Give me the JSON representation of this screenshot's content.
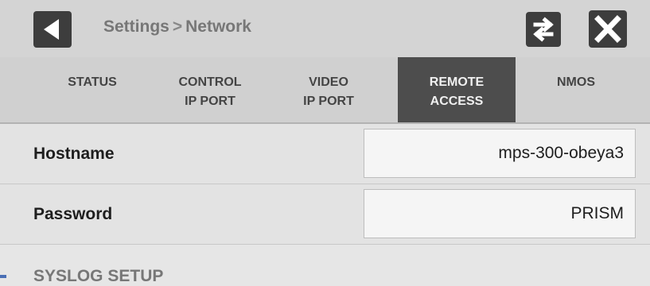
{
  "header": {
    "breadcrumb_parent": "Settings",
    "breadcrumb_separator": ">",
    "breadcrumb_current": "Network",
    "icons": {
      "back": "back-arrow-icon",
      "swap": "swap-arrows-icon",
      "close": "close-x-icon"
    }
  },
  "tabs": [
    {
      "label": "STATUS",
      "active": false
    },
    {
      "label": "CONTROL\nIP PORT",
      "active": false
    },
    {
      "label": "VIDEO\nIP PORT",
      "active": false
    },
    {
      "label": "REMOTE\nACCESS",
      "active": true
    },
    {
      "label": "NMOS",
      "active": false
    }
  ],
  "fields": {
    "hostname": {
      "label": "Hostname",
      "value": "mps-300-obeya3"
    },
    "password": {
      "label": "Password",
      "value": "PRISM"
    }
  },
  "section_heading": "SYSLOG SETUP",
  "colors": {
    "active_tab_bg": "#4d4d4d",
    "button_bg": "#3d3d3d",
    "panel_bg": "#e3e3e3"
  }
}
